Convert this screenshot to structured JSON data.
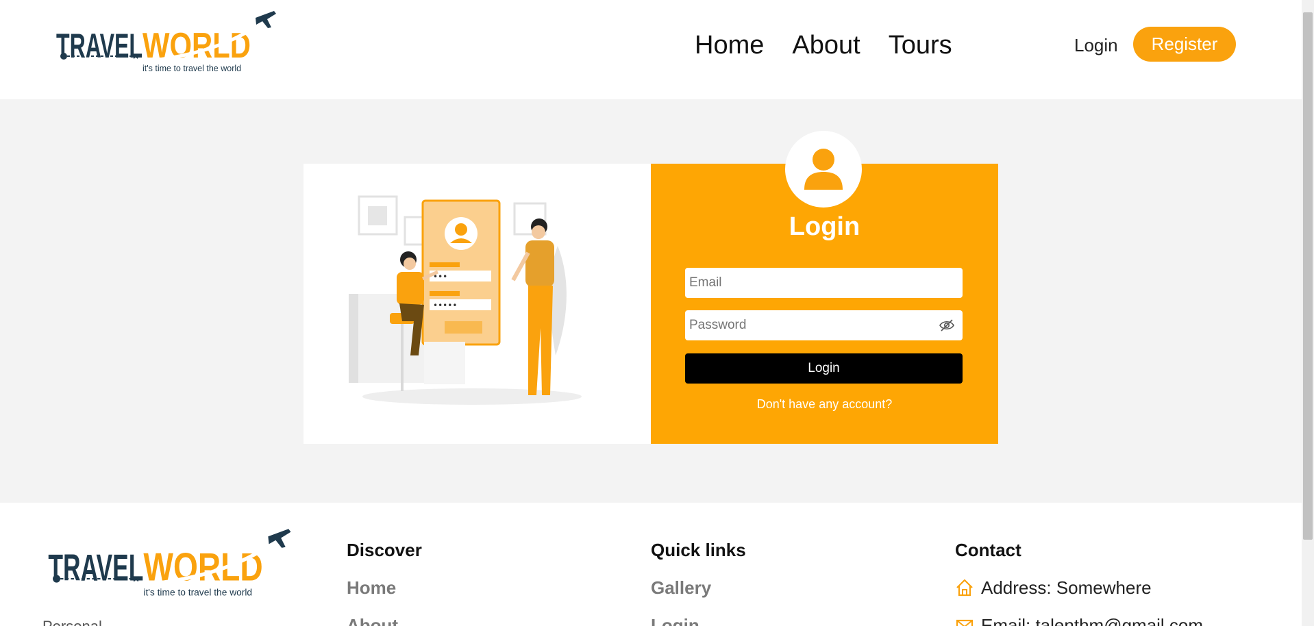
{
  "header": {
    "logo": {
      "word1": "TRAVEL",
      "word2": "WORLD",
      "tagline": "it's time to travel the world"
    },
    "nav": [
      "Home",
      "About",
      "Tours"
    ],
    "login_label": "Login",
    "register_label": "Register"
  },
  "login_form": {
    "title": "Login",
    "email_placeholder": "Email",
    "password_placeholder": "Password",
    "submit_label": "Login",
    "signup_prompt": "Don't have any account?"
  },
  "footer": {
    "discover": {
      "heading": "Discover",
      "links": [
        "Home",
        "About"
      ]
    },
    "quick_links": {
      "heading": "Quick links",
      "links": [
        "Gallery",
        "Login"
      ]
    },
    "contact": {
      "heading": "Contact",
      "address": "Address: Somewhere",
      "email": "Email: talenthm@gmail.com"
    },
    "description": "Personal"
  },
  "colors": {
    "accent": "#faa20e",
    "form_bg": "#fea604",
    "dark": "#1f3a4d",
    "page_bg": "#f3f3f3",
    "button_dark": "#000000"
  },
  "icons": {
    "user": "user-icon",
    "eye": "eye-slash-icon",
    "home": "home-icon",
    "plane": "airplane-icon"
  }
}
